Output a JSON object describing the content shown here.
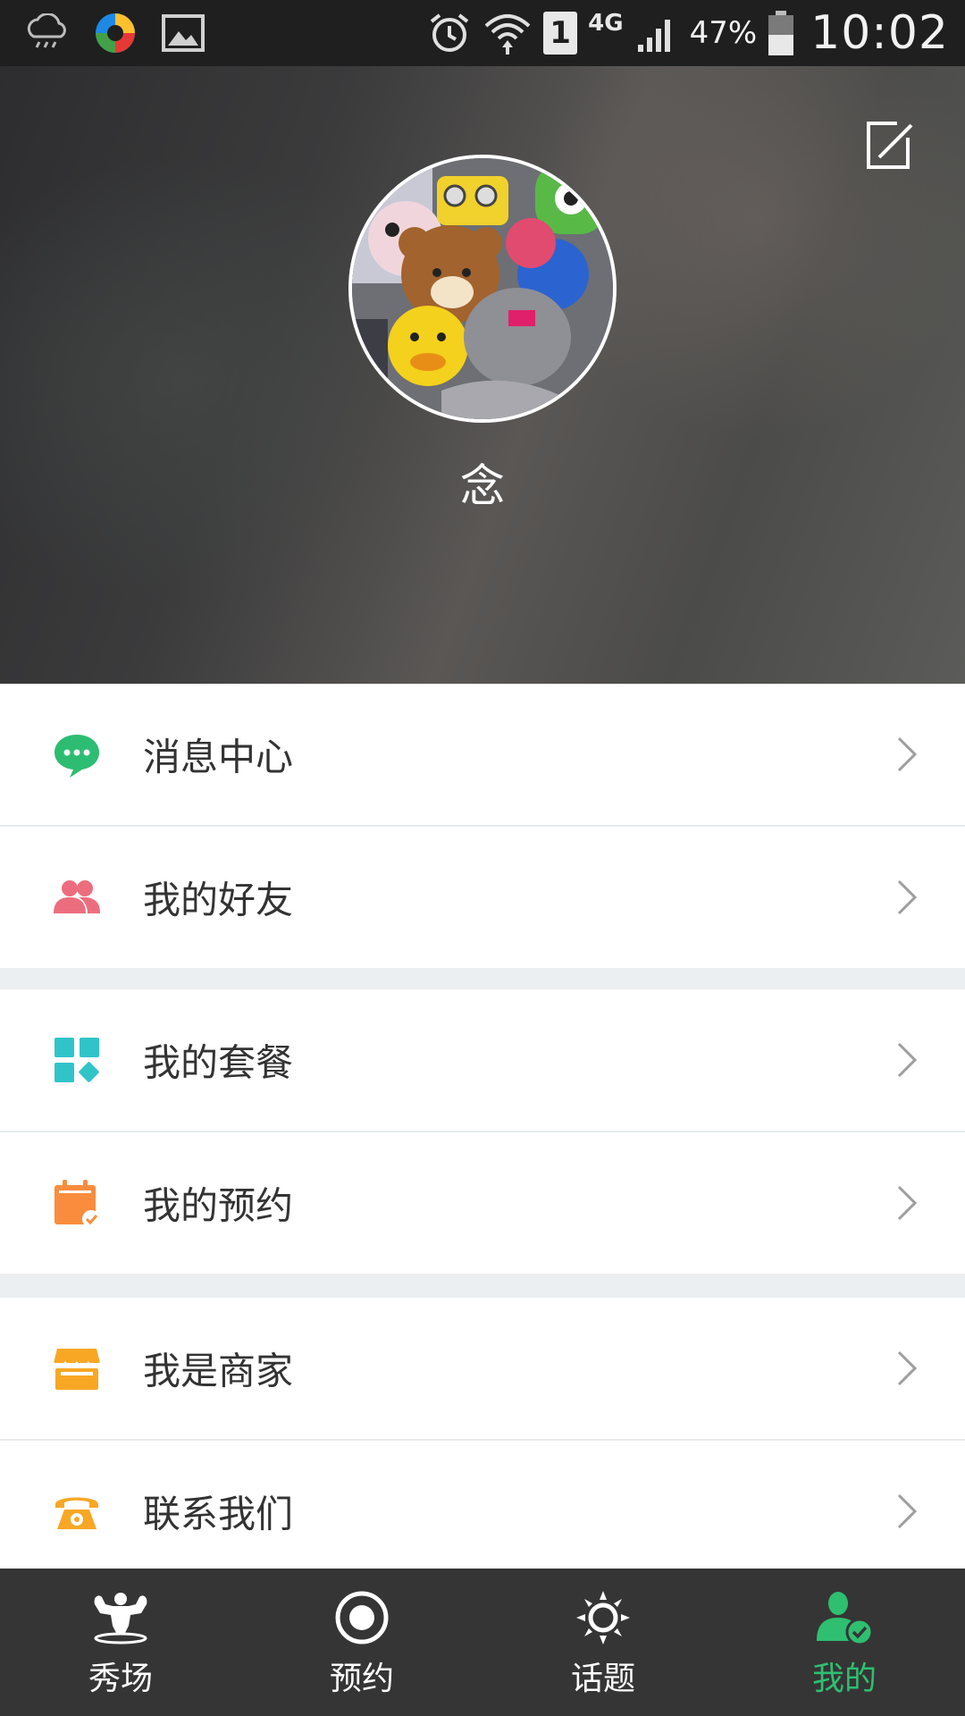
{
  "status_bar": {
    "battery_percent": "47%",
    "time": "10:02",
    "network": "4G",
    "sim": "1",
    "icons": [
      "weather-rain-icon",
      "app-launcher-icon",
      "gallery-icon",
      "alarm-icon",
      "wifi-icon",
      "sim-icon",
      "signal-icon",
      "battery-icon"
    ]
  },
  "profile": {
    "username": "念",
    "edit_icon": "edit-icon"
  },
  "menu": {
    "groups": [
      {
        "items": [
          {
            "label": "消息中心",
            "icon": "message-bubble-icon",
            "color": "#2dbd72"
          },
          {
            "label": "我的好友",
            "icon": "friends-icon",
            "color": "#ec6e7e"
          }
        ]
      },
      {
        "items": [
          {
            "label": "我的套餐",
            "icon": "package-grid-icon",
            "color": "#30c4c9"
          },
          {
            "label": "我的预约",
            "icon": "calendar-icon",
            "color": "#f98d3d"
          }
        ]
      },
      {
        "items": [
          {
            "label": "我是商家",
            "icon": "store-icon",
            "color": "#f7a724"
          },
          {
            "label": "联系我们",
            "icon": "telephone-icon",
            "color": "#f7a724"
          }
        ]
      }
    ]
  },
  "bottom_nav": {
    "items": [
      {
        "label": "秀场",
        "icon": "bodybuilder-icon",
        "active": false
      },
      {
        "label": "预约",
        "icon": "record-icon",
        "active": false
      },
      {
        "label": "话题",
        "icon": "sun-icon",
        "active": false
      },
      {
        "label": "我的",
        "icon": "user-check-icon",
        "active": true
      }
    ],
    "active_color": "#2fbf71"
  }
}
